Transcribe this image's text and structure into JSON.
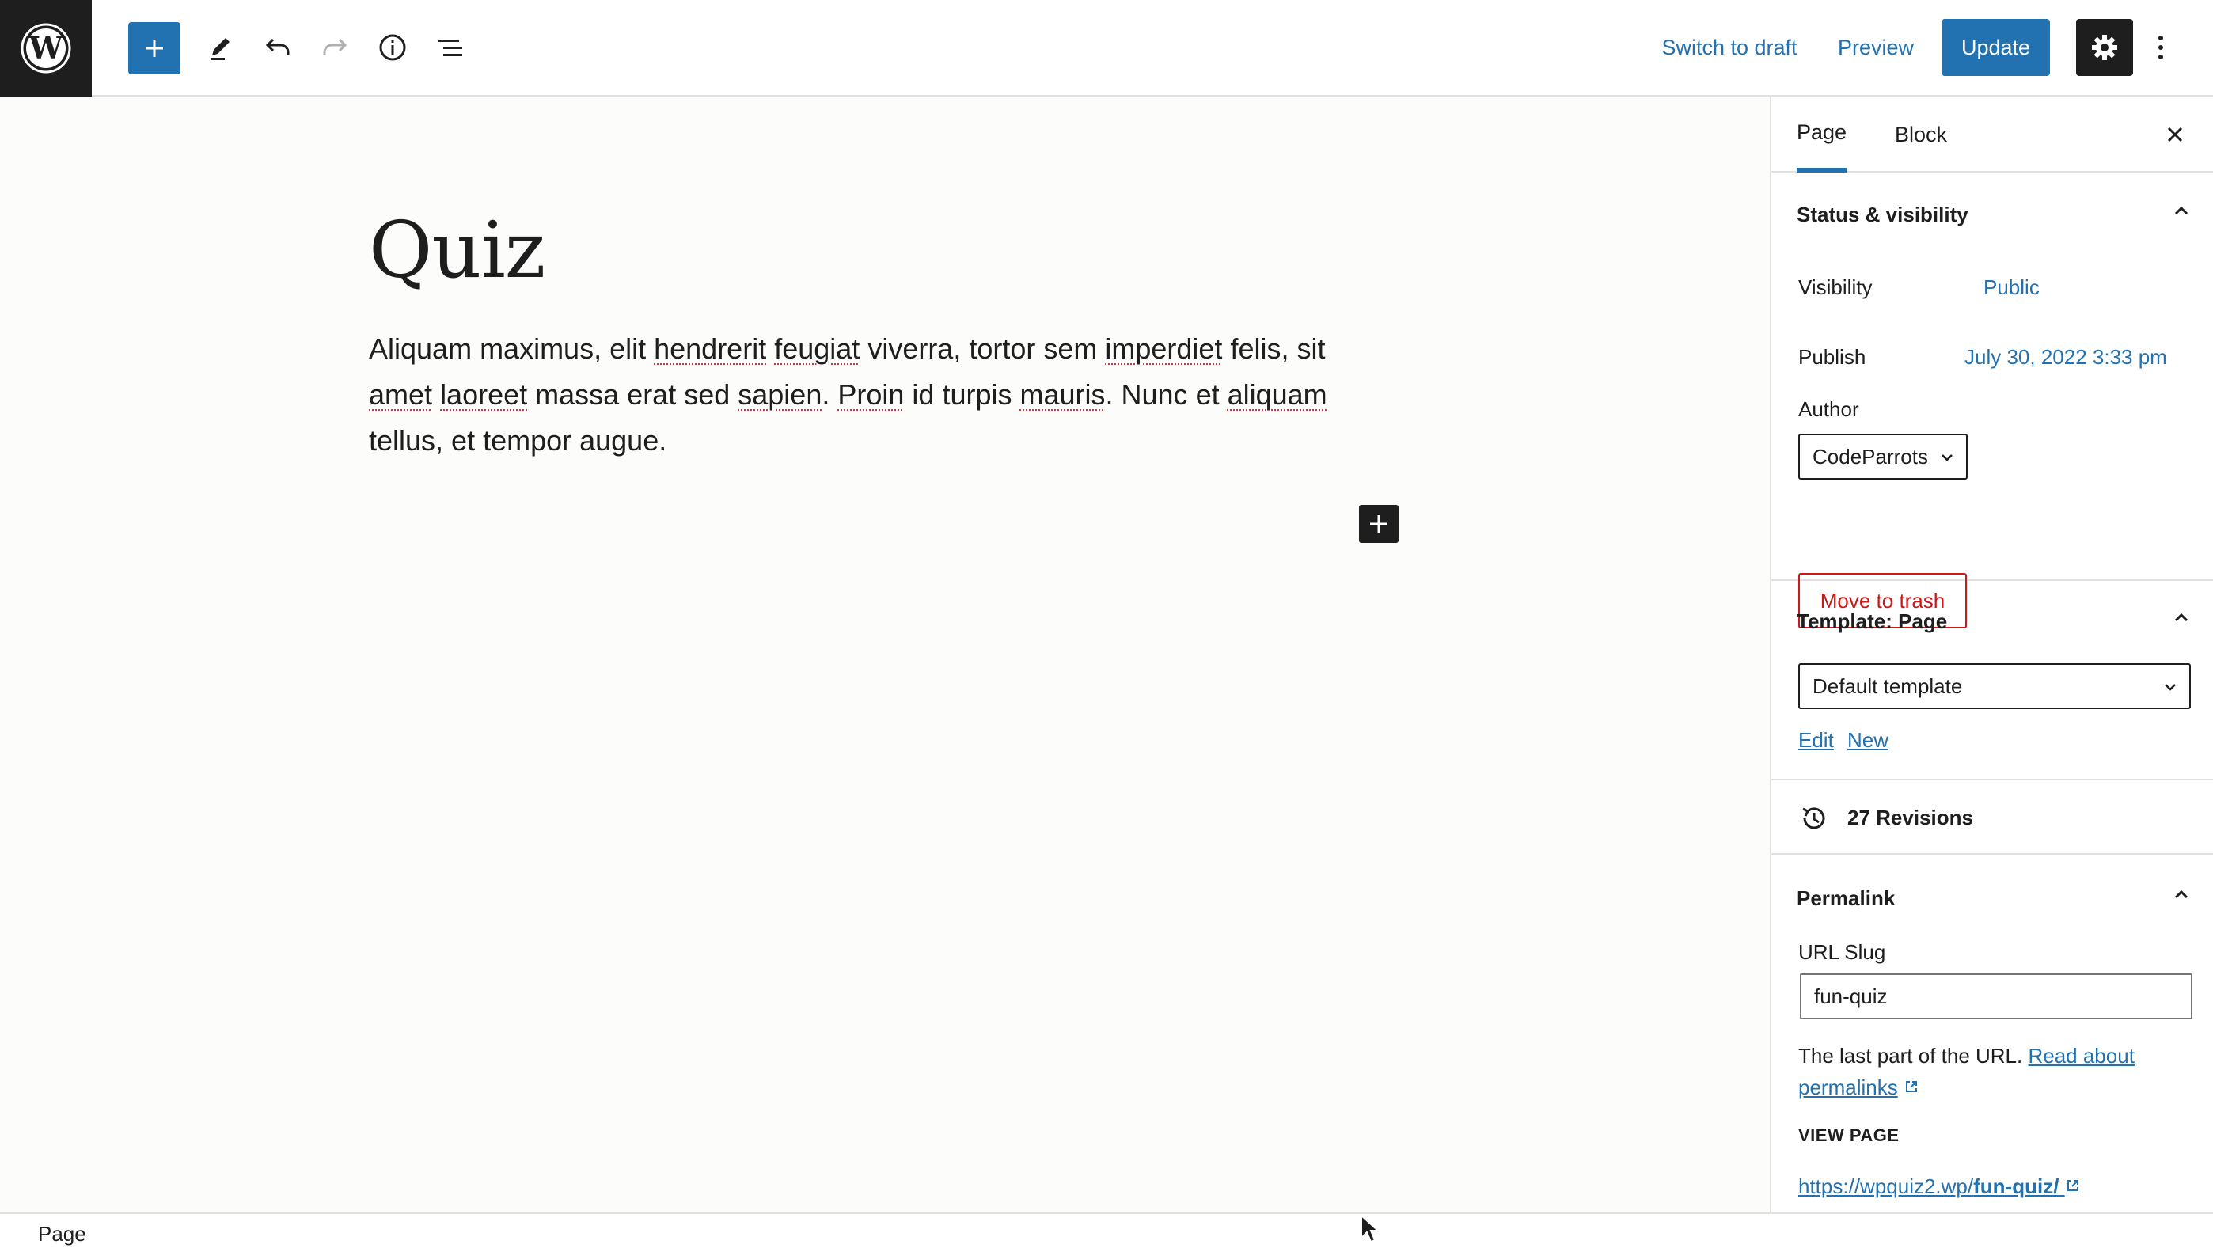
{
  "toolbar": {
    "switch_to_draft": "Switch to draft",
    "preview": "Preview",
    "update": "Update"
  },
  "post": {
    "title": "Quiz",
    "paragraph_parts": [
      "Aliquam maximus, elit ",
      "hendrerit",
      " ",
      "feugiat",
      " viverra, tortor sem ",
      "imperdiet",
      " felis, sit ",
      "amet",
      " ",
      "laoreet",
      " massa erat sed ",
      "sapien",
      ". ",
      "Proin",
      " id turpis ",
      "mauris",
      ". Nunc et ",
      "aliquam",
      " tellus, et tempor augue."
    ]
  },
  "sidebar": {
    "tabs": {
      "page": "Page",
      "block": "Block"
    },
    "status": {
      "heading": "Status & visibility",
      "visibility_label": "Visibility",
      "visibility_value": "Public",
      "publish_label": "Publish",
      "publish_value": "July 30, 2022 3:33 pm",
      "author_label": "Author",
      "author_value": "CodeParrots",
      "trash": "Move to trash"
    },
    "template": {
      "heading": "Template: Page",
      "selected": "Default template",
      "edit": "Edit",
      "new": "New"
    },
    "revisions": {
      "label": "27 Revisions"
    },
    "permalink": {
      "heading": "Permalink",
      "slug_label": "URL Slug",
      "slug_value": "fun-quiz",
      "help_text": "The last part of the URL. ",
      "help_link_1": "Read about",
      "help_link_2": "permalinks",
      "view_page": "VIEW PAGE",
      "url_prefix": "https://wpquiz2.wp/",
      "url_slug": "fun-quiz/"
    }
  },
  "footer": {
    "breadcrumb": "Page"
  },
  "colors": {
    "accent": "#2271b1",
    "danger": "#cc1818",
    "dark": "#1e1e1e"
  }
}
